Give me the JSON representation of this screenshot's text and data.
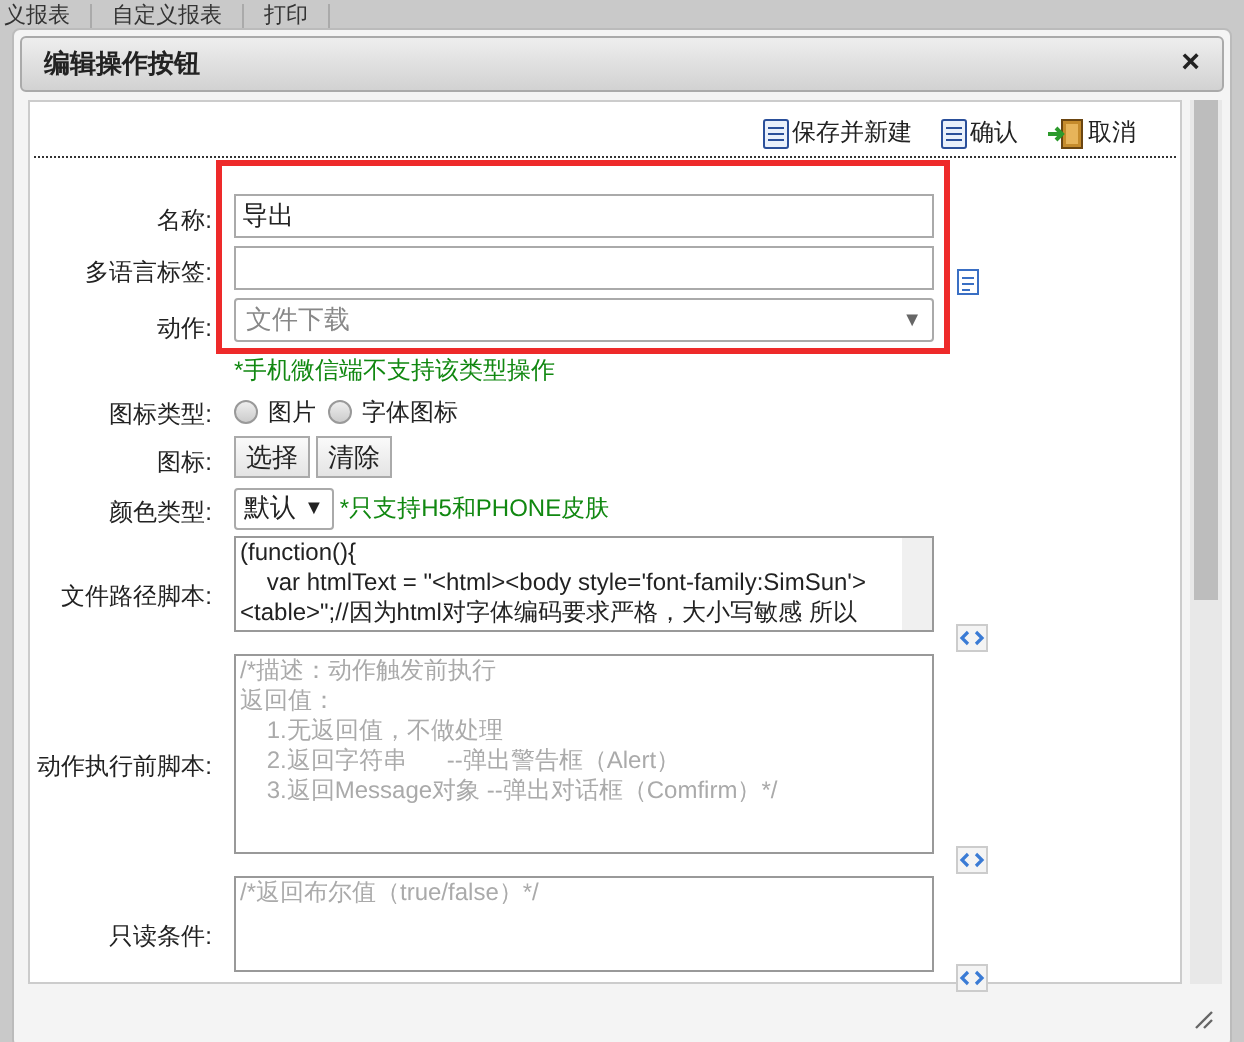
{
  "background_tabs": [
    "义报表",
    "自定义报表",
    "打印"
  ],
  "dialog": {
    "title": "编辑操作按钮",
    "close": "×"
  },
  "toolbar": [
    {
      "label": "保存并新建",
      "kind": "save"
    },
    {
      "label": "确认",
      "kind": "save"
    },
    {
      "label": "取消",
      "kind": "exit"
    }
  ],
  "fields": [
    {
      "kind": "input",
      "label": "名称:",
      "value": "导出"
    },
    {
      "kind": "translatable_input",
      "label": "多语言标签:"
    },
    {
      "kind": "select",
      "label": "动作:",
      "value": "文件下载",
      "arrow": "▼",
      "note": "*手机微信端不支持该类型操作"
    },
    {
      "kind": "radio",
      "label": "图标类型:",
      "options": [
        {
          "label": "图片",
          "selected": false
        },
        {
          "label": "字体图标",
          "selected": false
        }
      ]
    },
    {
      "kind": "buttons",
      "label": "图标:",
      "buttons": [
        "选择",
        "清除"
      ]
    },
    {
      "kind": "small_select",
      "label": "颜色类型:",
      "value": "默认",
      "arrow": "▼",
      "note": "*只支持H5和PHONE皮肤"
    },
    {
      "kind": "script",
      "label": "文件路径脚本:",
      "value_lines": [
        "(function(){",
        "    var htmlText = \"<html><body style='font-family:SimSun'>",
        "<table>\";//因为html对字体编码要求严格，大小写敏感 所以"
      ]
    },
    {
      "kind": "tall_script",
      "label": "动作执行前脚本:",
      "placeholder_lines": [
        "/*描述：动作触发前执行",
        "返回值：",
        "    1.无返回值，不做处理",
        "    2.返回字符串      --弹出警告框（Alert）",
        "    3.返回Message对象 --弹出对话框（Comfirm）*/"
      ]
    },
    {
      "kind": "script",
      "label": "只读条件:",
      "placeholder_lines": [
        "/*返回布尔值（true/false）*/"
      ]
    }
  ]
}
